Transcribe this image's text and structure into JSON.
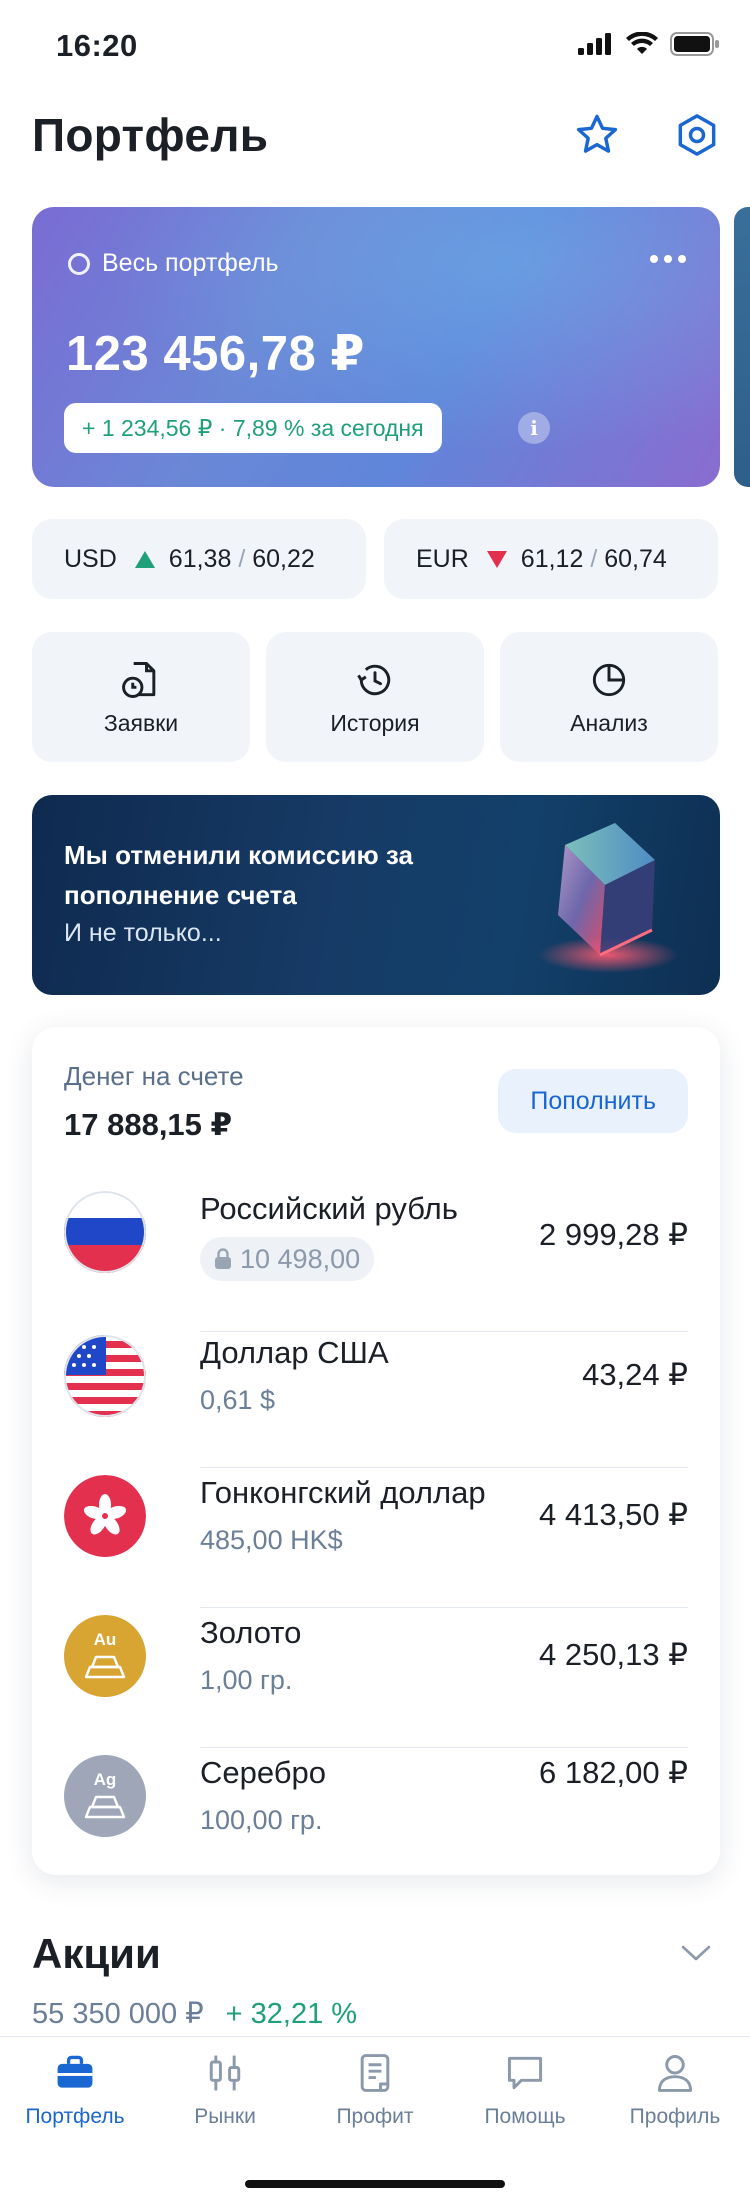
{
  "status": {
    "time": "16:20"
  },
  "header": {
    "title": "Портфель",
    "favorite_icon": "star-icon",
    "settings_icon": "hexagon-settings-icon"
  },
  "portfolio": {
    "scope_label": "Весь портфель",
    "total": "123 456,78 ₽",
    "change": "+ 1 234,56 ₽ · 7,89 % за сегодня",
    "info": "i",
    "gradient": [
      "#7a6cd4",
      "#5f86da"
    ]
  },
  "fx": [
    {
      "code": "USD",
      "direction": "up",
      "buy": "61,38",
      "slash": "/",
      "sell": "60,22"
    },
    {
      "code": "EUR",
      "direction": "down",
      "buy": "61,12",
      "slash": "/",
      "sell": "60,74"
    }
  ],
  "actions": [
    {
      "label": "Заявки",
      "icon": "orders-clock-icon"
    },
    {
      "label": "История",
      "icon": "history-icon"
    },
    {
      "label": "Анализ",
      "icon": "pie-chart-icon"
    }
  ],
  "promo": {
    "title": "Мы отменили комиссию за пополнение счета",
    "subtitle": "И не только..."
  },
  "money": {
    "label": "Денег на счете",
    "total": "17 888,15 ₽",
    "topup_label": "Пополнить",
    "currencies": [
      {
        "name": "Российский рубль",
        "sub": "10 498,00",
        "amount": "2 999,28 ₽",
        "icon": "russia-flag-icon",
        "locked": true
      },
      {
        "name": "Доллар США",
        "sub": "0,61 $",
        "amount": "43,24 ₽",
        "icon": "usa-flag-icon",
        "locked": false
      },
      {
        "name": "Гонконгский доллар",
        "sub": "485,00 HK$",
        "amount": "4 413,50 ₽",
        "icon": "hong-kong-flag-icon",
        "locked": false
      },
      {
        "name": "Золото",
        "sub": "1,00 гр.",
        "amount": "4 250,13 ₽",
        "icon": "gold-bar-icon",
        "badge": "Au",
        "locked": false
      },
      {
        "name": "Серебро",
        "sub": "100,00 гр.",
        "amount": "6 182,00 ₽",
        "icon": "silver-bar-icon",
        "badge": "Ag",
        "locked": false
      }
    ]
  },
  "stocks": {
    "title": "Акции",
    "value": "55 350 000 ₽",
    "gain": "+ 32,21 %"
  },
  "tabbar": {
    "tabs": [
      {
        "label": "Портфель",
        "icon": "briefcase-icon",
        "active": true
      },
      {
        "label": "Рынки",
        "icon": "candles-icon",
        "active": false
      },
      {
        "label": "Профит",
        "icon": "document-icon",
        "active": false
      },
      {
        "label": "Помощь",
        "icon": "chat-bubble-icon",
        "active": false
      },
      {
        "label": "Профиль",
        "icon": "person-icon",
        "active": false
      }
    ]
  },
  "colors": {
    "accent": "#1a66d2",
    "positive": "#1fa07a",
    "negative": "#e3304f",
    "muted": "#6b7f98"
  }
}
